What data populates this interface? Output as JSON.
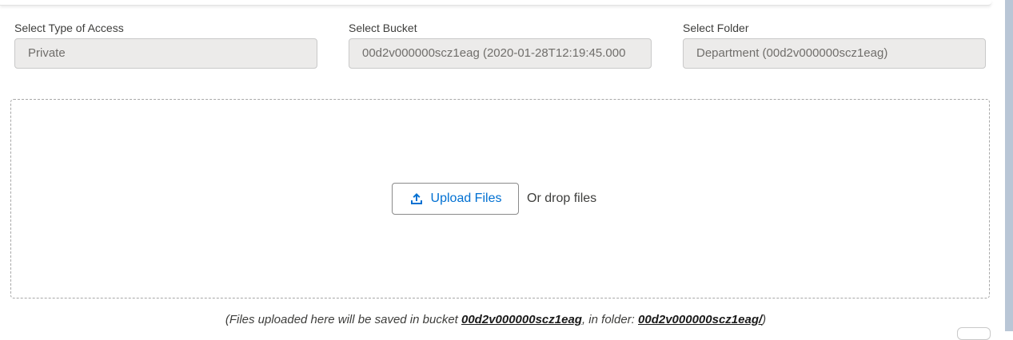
{
  "access": {
    "label": "Select Type of Access",
    "value": "Private"
  },
  "bucket": {
    "label": "Select Bucket",
    "value": "00d2v000000scz1eag (2020-01-28T12:19:45.000"
  },
  "folder": {
    "label": "Select Folder",
    "value": "Department (00d2v000000scz1eag)"
  },
  "dropzone": {
    "upload_label": "Upload Files",
    "upload_icon": "upload-icon",
    "drop_text": "Or drop files"
  },
  "footnote": {
    "prefix": "(Files uploaded here will be saved in bucket ",
    "bucket": "00d2v000000scz1eag",
    "middle": ", in folder: ",
    "folder": "00d2v000000scz1eag/",
    "suffix": ")"
  },
  "colors": {
    "accent": "#0070d2",
    "field_background": "#ecebea",
    "scrollbar": "#b9c6d6"
  }
}
